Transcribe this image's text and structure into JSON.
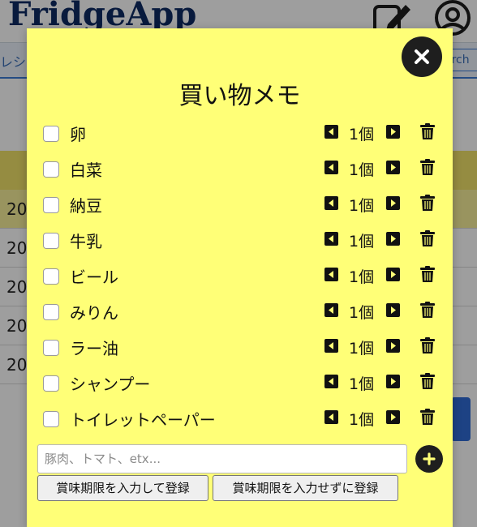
{
  "app": {
    "logo": "FridgeApp",
    "nav_left_fragment": "レシ",
    "search_fragment": "arch"
  },
  "background_table": {
    "rows": [
      "20",
      "20",
      "20",
      "20",
      "20"
    ]
  },
  "modal": {
    "title": "買い物メモ",
    "items": [
      {
        "name": "卵",
        "qty": "1個",
        "checked": false
      },
      {
        "name": "白菜",
        "qty": "1個",
        "checked": false
      },
      {
        "name": "納豆",
        "qty": "1個",
        "checked": false
      },
      {
        "name": "牛乳",
        "qty": "1個",
        "checked": false
      },
      {
        "name": "ビール",
        "qty": "1個",
        "checked": false
      },
      {
        "name": "みりん",
        "qty": "1個",
        "checked": false
      },
      {
        "name": "ラー油",
        "qty": "1個",
        "checked": false
      },
      {
        "name": "シャンプー",
        "qty": "1個",
        "checked": false
      },
      {
        "name": "トイレットペーパー",
        "qty": "1個",
        "checked": false
      }
    ],
    "add_input": {
      "placeholder": "豚肉、トマト、etx...",
      "value": ""
    },
    "register_with_expiry": "賞味期限を入力して登録",
    "register_without_expiry": "賞味期限を入力せずに登録"
  },
  "colors": {
    "modal_background": "#ffff77",
    "logo": "#0d2a63",
    "icon_dark": "#1e1e1e"
  },
  "icons": {
    "close": "close-icon",
    "decrement": "caret-left-square-icon",
    "increment": "caret-right-square-icon",
    "delete": "trash-icon",
    "add": "plus-circle-icon",
    "edit": "pencil-square-icon",
    "user": "user-circle-icon"
  }
}
